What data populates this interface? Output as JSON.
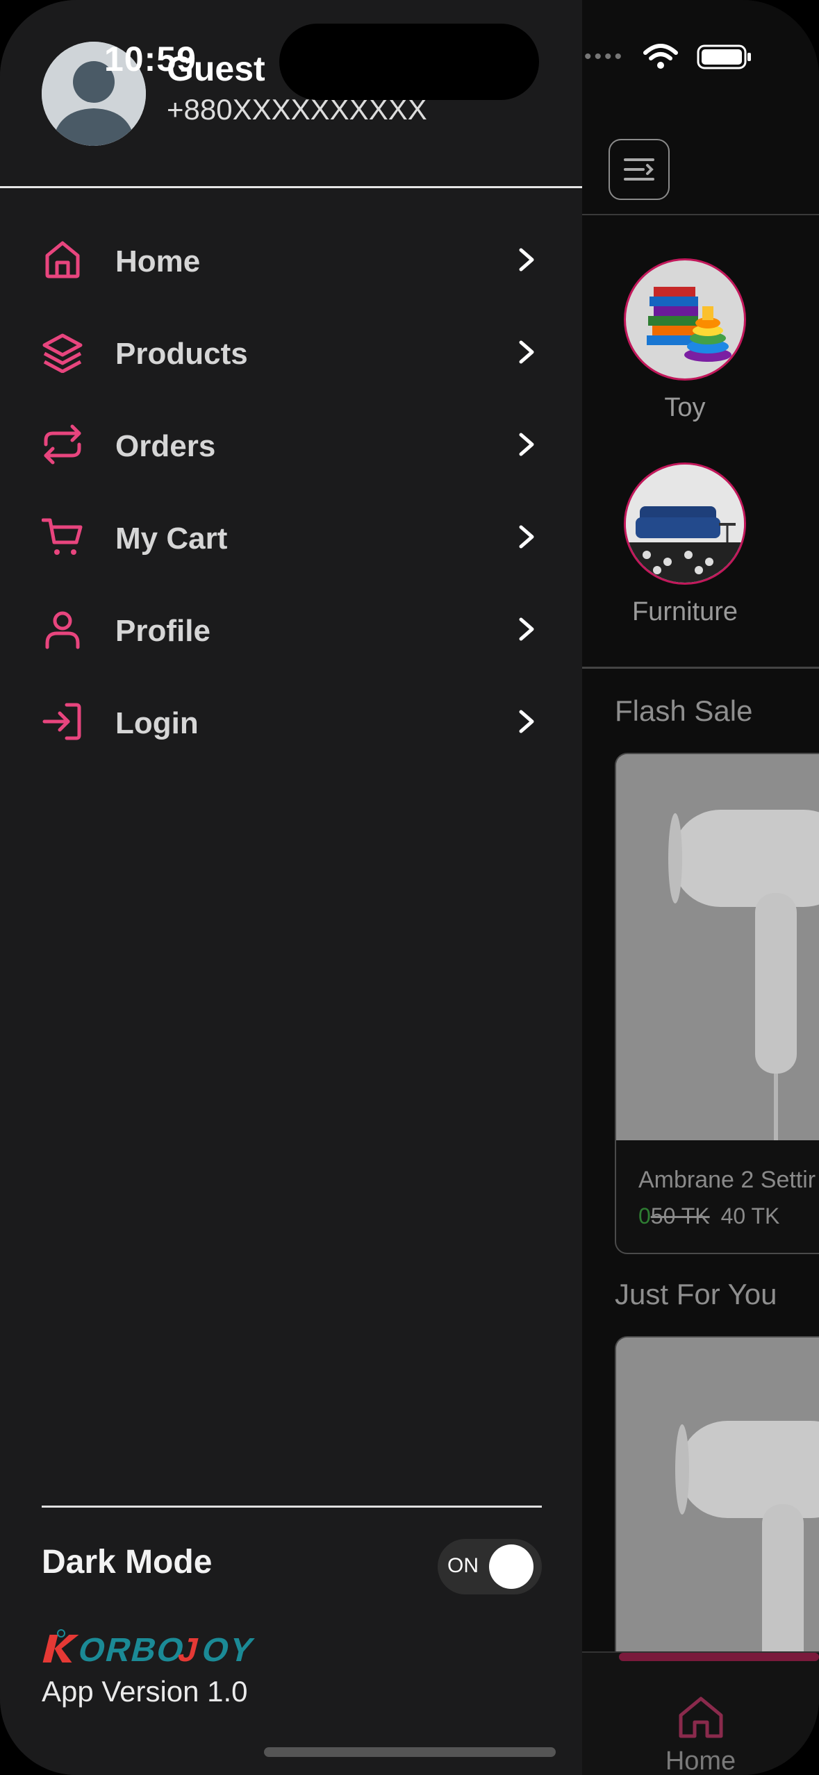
{
  "status_bar": {
    "time": "10:59"
  },
  "drawer": {
    "user": {
      "name": "Guest",
      "phone": "+880XXXXXXXXXX"
    },
    "menu": [
      {
        "label": "Home",
        "icon": "home-icon"
      },
      {
        "label": "Products",
        "icon": "layers-icon"
      },
      {
        "label": "Orders",
        "icon": "repeat-icon"
      },
      {
        "label": "My Cart",
        "icon": "cart-icon"
      },
      {
        "label": "Profile",
        "icon": "user-icon"
      },
      {
        "label": "Login",
        "icon": "login-icon"
      }
    ],
    "dark_mode": {
      "label": "Dark Mode",
      "toggle_text": "ON",
      "enabled": true
    },
    "brand": "KORBOJOY",
    "app_version": "App Version 1.0"
  },
  "background_app": {
    "categories": [
      {
        "label": "Toy"
      },
      {
        "label": "Furniture"
      }
    ],
    "flash_sale": {
      "title": "Flash Sale",
      "product": {
        "name": "Ambrane 2 Settir",
        "prefix": "0",
        "old_price": "50 TK",
        "price": "40 TK"
      }
    },
    "just_for_you": {
      "title": "Just For You"
    },
    "bottom_nav": {
      "home_label": "Home"
    }
  },
  "colors": {
    "accent": "#e8457e",
    "drawer_bg": "#1b1b1c",
    "app_bg": "#0d0d0d"
  }
}
